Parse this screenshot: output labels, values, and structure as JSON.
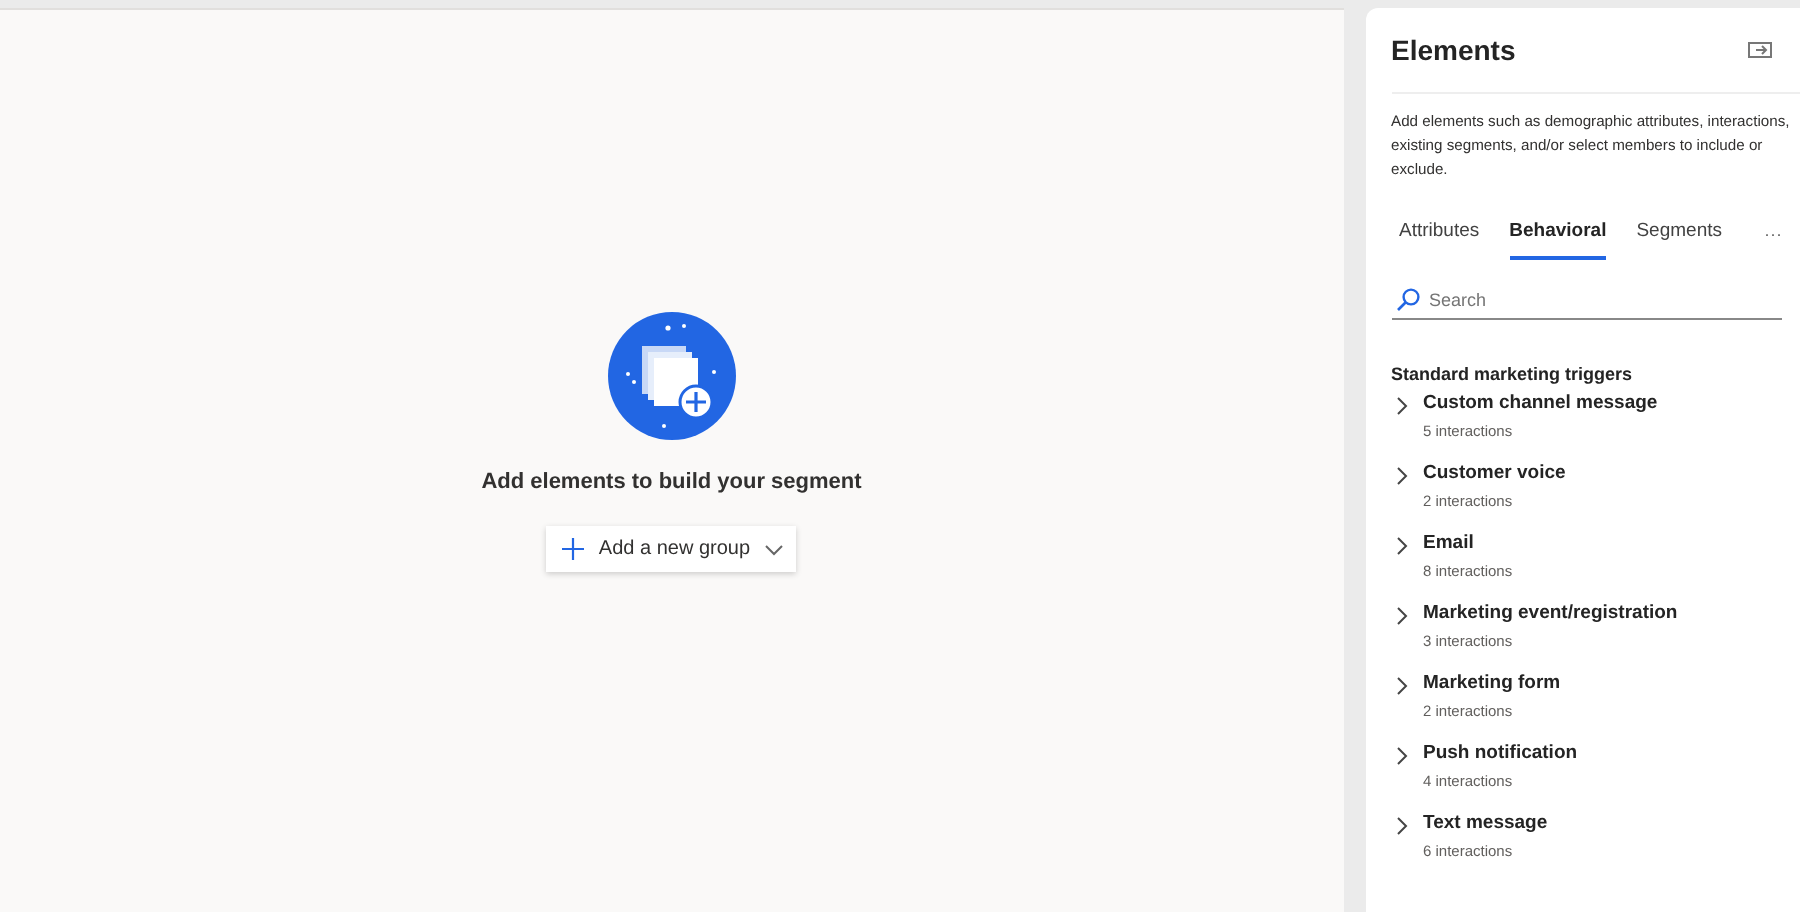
{
  "canvas": {
    "empty_message": "Add elements to build your segment",
    "add_button": {
      "label": "Add a new group"
    }
  },
  "panel": {
    "title": "Elements",
    "description": "Add elements such as demographic attributes, interactions, existing segments, and/or select members to include or exclude.",
    "tabs": [
      {
        "label": "Attributes",
        "selected": false
      },
      {
        "label": "Behavioral",
        "selected": true
      },
      {
        "label": "Segments",
        "selected": false
      }
    ],
    "more": "···",
    "search": {
      "placeholder": "Search"
    },
    "section_title": "Standard marketing triggers",
    "items": [
      {
        "name": "Custom channel message",
        "count": "5 interactions",
        "expanded": false
      },
      {
        "name": "Customer voice",
        "count": "2 interactions",
        "expanded": false
      },
      {
        "name": "Email",
        "count": "8 interactions",
        "expanded": false
      },
      {
        "name": "Marketing event/registration",
        "count": "3 interactions",
        "expanded": false
      },
      {
        "name": "Marketing form",
        "count": "2 interactions",
        "expanded": false
      },
      {
        "name": "Push notification",
        "count": "4 interactions",
        "expanded": false
      },
      {
        "name": "Text message",
        "count": "6 interactions",
        "expanded": false
      }
    ]
  }
}
